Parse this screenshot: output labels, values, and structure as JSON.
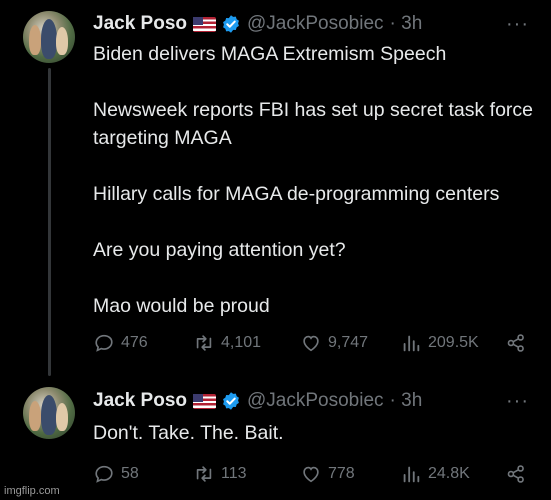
{
  "tweets": [
    {
      "author_name": "Jack Poso",
      "handle": "@JackPosobiec",
      "time": "· 3h",
      "text": "Biden delivers MAGA Extremism Speech\n\nNewsweek reports FBI has set up secret task force targeting MAGA\n\nHillary calls for MAGA de-programming centers\n\nAre you paying attention yet?\n\nMao would be proud",
      "replies": "476",
      "retweets": "4,101",
      "likes": "9,747",
      "views": "209.5K"
    },
    {
      "author_name": "Jack Poso",
      "handle": "@JackPosobiec",
      "time": "· 3h",
      "text": "Don't. Take. The. Bait.",
      "replies": "58",
      "retweets": "113",
      "likes": "778",
      "views": "24.8K"
    }
  ],
  "more_icon": "···",
  "icons": [
    "reply-icon",
    "retweet-icon",
    "like-icon",
    "views-icon",
    "share-icon",
    "verified-badge-icon",
    "us-flag-icon"
  ],
  "colors": {
    "background": "#000000",
    "text": "#e7e9ea",
    "muted": "#71767b",
    "verified": "#1d9bf0"
  },
  "watermark": "imgflip.com"
}
